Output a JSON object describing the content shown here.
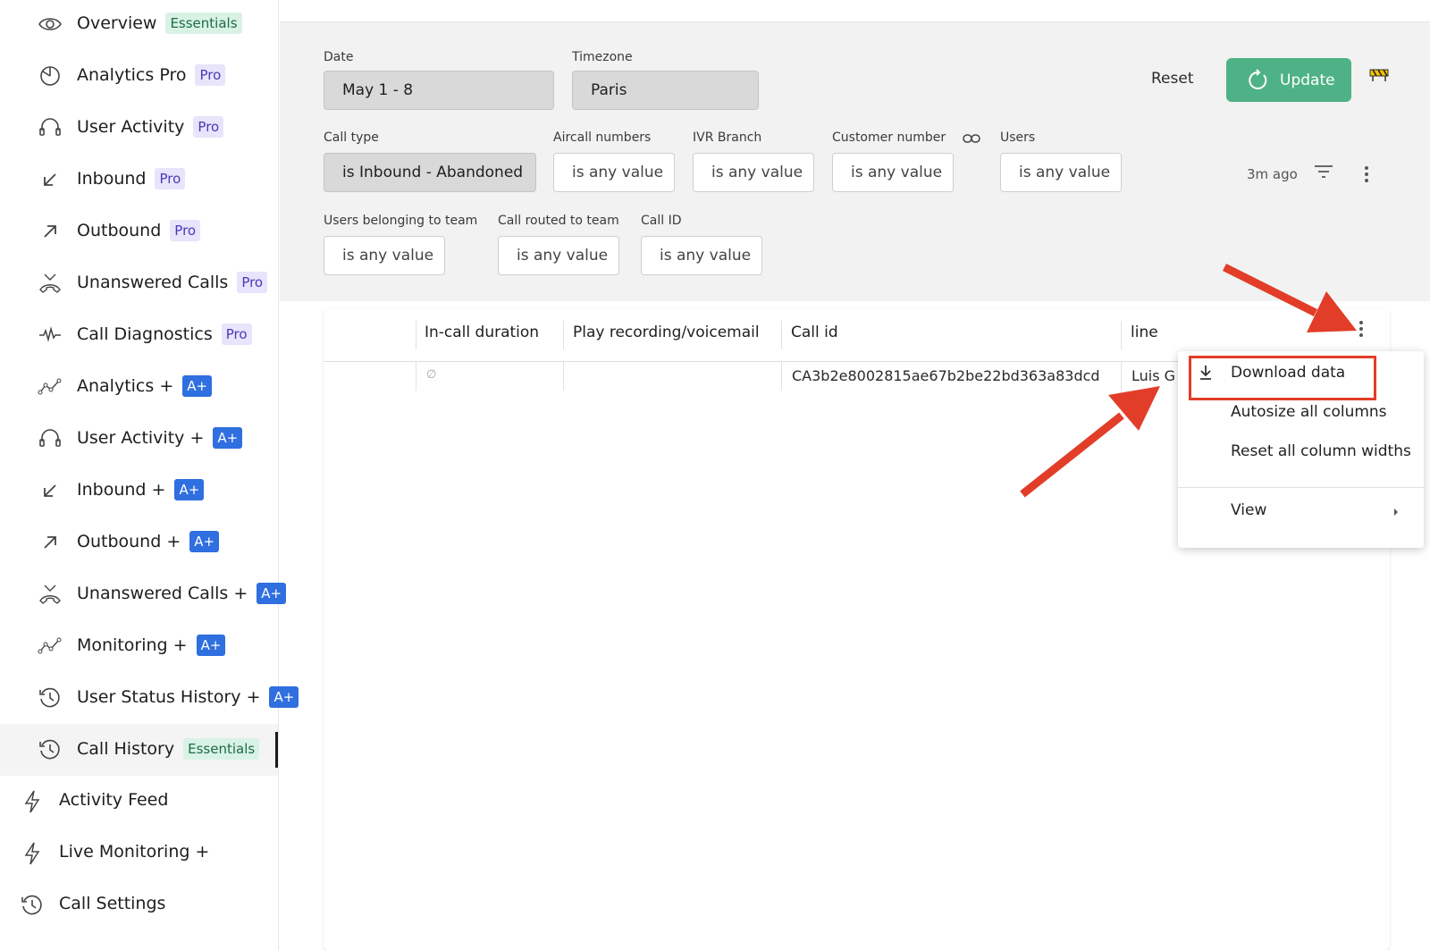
{
  "sidebar": {
    "items": [
      {
        "label": "Overview",
        "badge": "Essentials",
        "badge_type": "essentials",
        "icon": "eye-icon"
      },
      {
        "label": "Analytics Pro",
        "badge": "Pro",
        "badge_type": "pro",
        "icon": "pie-chart-icon"
      },
      {
        "label": "User Activity",
        "badge": "Pro",
        "badge_type": "pro",
        "icon": "headset-icon"
      },
      {
        "label": "Inbound",
        "badge": "Pro",
        "badge_type": "pro",
        "icon": "arrow-down-left-icon"
      },
      {
        "label": "Outbound",
        "badge": "Pro",
        "badge_type": "pro",
        "icon": "arrow-up-right-icon"
      },
      {
        "label": "Unanswered Calls",
        "badge": "Pro",
        "badge_type": "pro",
        "icon": "missed-call-icon"
      },
      {
        "label": "Call Diagnostics",
        "badge": "Pro",
        "badge_type": "pro",
        "icon": "pulse-icon"
      },
      {
        "label": "Analytics +",
        "badge": "A+",
        "badge_type": "aplus",
        "icon": "line-chart-icon"
      },
      {
        "label": "User Activity +",
        "badge": "A+",
        "badge_type": "aplus",
        "icon": "headset-icon"
      },
      {
        "label": "Inbound +",
        "badge": "A+",
        "badge_type": "aplus",
        "icon": "arrow-down-left-icon"
      },
      {
        "label": "Outbound +",
        "badge": "A+",
        "badge_type": "aplus",
        "icon": "arrow-up-right-icon"
      },
      {
        "label": "Unanswered Calls +",
        "badge": "A+",
        "badge_type": "aplus",
        "icon": "missed-call-icon"
      },
      {
        "label": "Monitoring +",
        "badge": "A+",
        "badge_type": "aplus",
        "icon": "line-chart-icon"
      },
      {
        "label": "User Status History +",
        "badge": "A+",
        "badge_type": "aplus",
        "icon": "history-icon"
      },
      {
        "label": "Call History",
        "badge": "Essentials",
        "badge_type": "essentials",
        "icon": "history-icon",
        "active": true
      }
    ],
    "top_items": [
      {
        "label": "Activity Feed",
        "icon": "lightning-icon"
      },
      {
        "label": "Live Monitoring +",
        "icon": "lightning-icon"
      },
      {
        "label": "Call Settings",
        "icon": "history-icon"
      }
    ]
  },
  "filters": {
    "date": {
      "label": "Date",
      "value": "May 1 - 8"
    },
    "timezone": {
      "label": "Timezone",
      "value": "Paris"
    },
    "reset_label": "Reset",
    "update_label": "Update",
    "call_type": {
      "label": "Call type",
      "value": "is Inbound - Abandoned"
    },
    "aircall_numbers": {
      "label": "Aircall numbers",
      "value": "is any value"
    },
    "ivr_branch": {
      "label": "IVR Branch",
      "value": "is any value"
    },
    "customer_number": {
      "label": "Customer number",
      "value": "is any value"
    },
    "users": {
      "label": "Users",
      "value": "is any value"
    },
    "users_team": {
      "label": "Users belonging to team",
      "value": "is any value"
    },
    "call_routed": {
      "label": "Call routed to team",
      "value": "is any value"
    },
    "call_id": {
      "label": "Call ID",
      "value": "is any value"
    },
    "last_updated": "3m ago"
  },
  "table": {
    "columns": [
      "In-call duration",
      "Play recording/voicemail",
      "Call id",
      "line"
    ],
    "rows": [
      {
        "duration": "∅",
        "recording": "",
        "call_id": "CA3b2e8002815ae67b2be22bd363a83dcd",
        "line": "Luis G"
      }
    ]
  },
  "menu": {
    "items": [
      "Download data",
      "Autosize all columns",
      "Reset all column widths",
      "View"
    ]
  },
  "colors": {
    "accent_green": "#4fb286",
    "annotation_red": "#e23d28",
    "badge_blue": "#2f6fe0"
  }
}
